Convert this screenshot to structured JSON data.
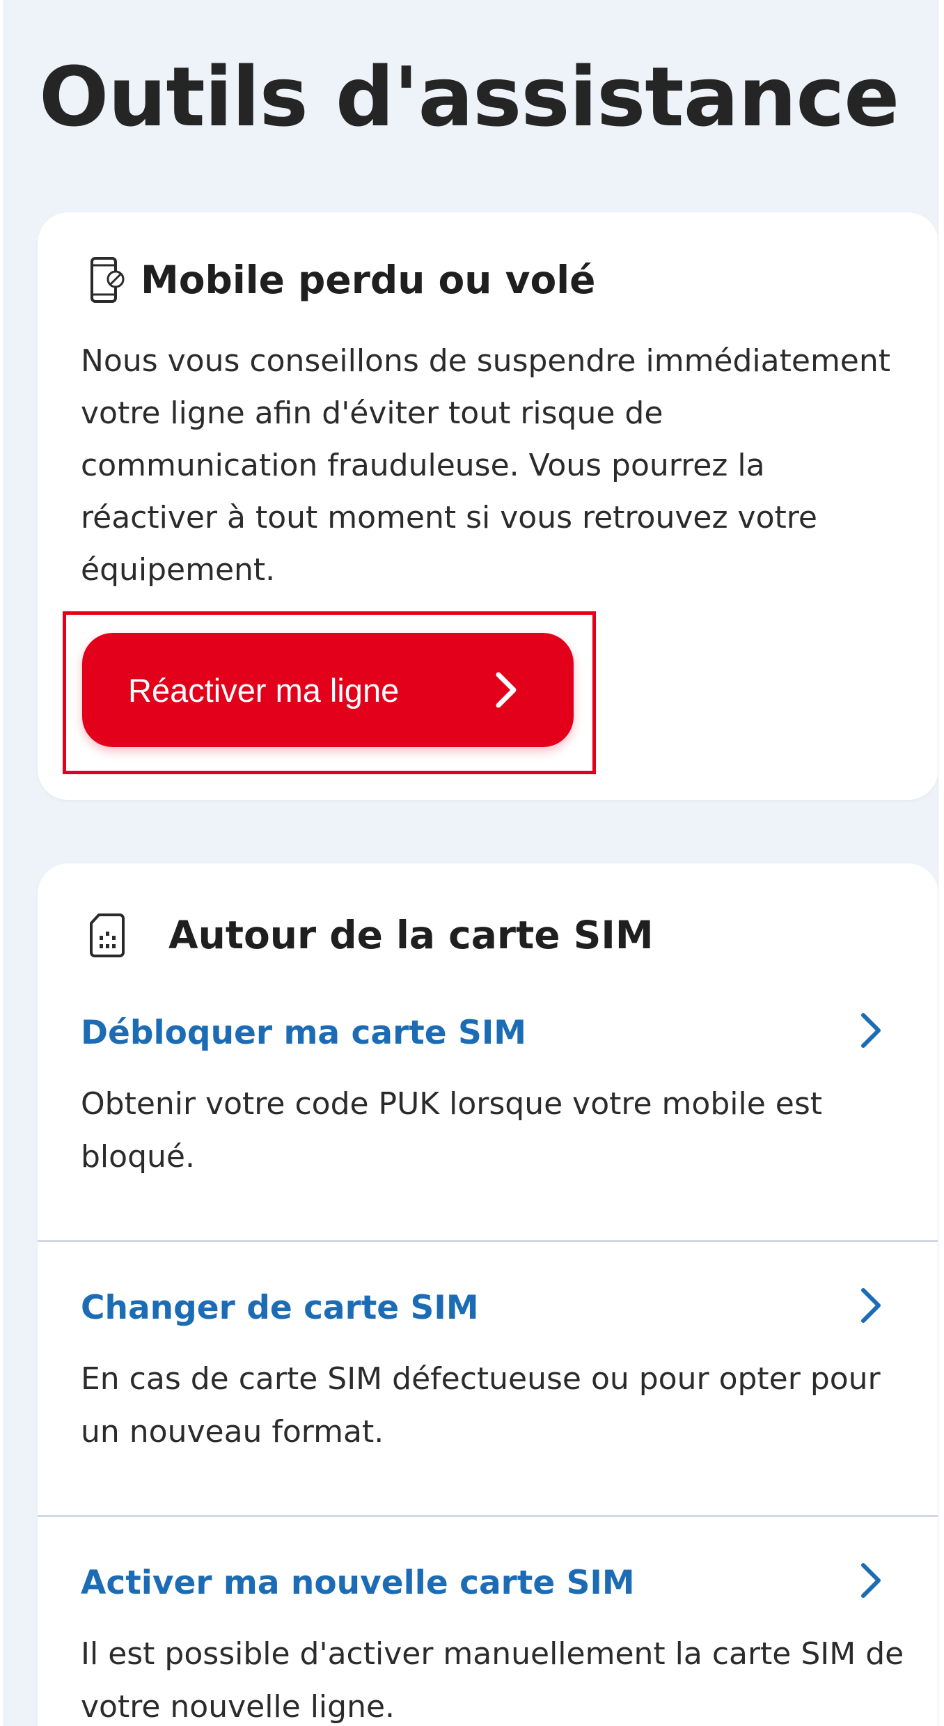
{
  "page": {
    "title": "Outils d'assistance"
  },
  "lost_card": {
    "title": "Mobile perdu ou volé",
    "icon": "phone-blocked-icon",
    "text": "Nous vous conseillons de suspendre immédiatement votre ligne afin d'éviter tout risque de communication frauduleuse. Vous pourrez la réactiver à tout moment si vous retrouvez votre équipement.",
    "button_label": "Réactiver ma ligne"
  },
  "sim_card": {
    "title": "Autour de la carte SIM",
    "icon": "sim-card-icon",
    "items": [
      {
        "label": "Débloquer ma carte SIM",
        "description": "Obtenir votre code PUK lorsque votre mobile est bloqué."
      },
      {
        "label": "Changer de carte SIM",
        "description": "En cas de carte SIM défectueuse ou pour opter pour un nouveau format."
      },
      {
        "label": "Activer ma nouvelle carte SIM",
        "description": "Il est possible d'activer manuellement la carte SIM de votre nouvelle ligne."
      }
    ]
  },
  "colors": {
    "brand_red": "#e2001a",
    "link_blue": "#1c6cb5",
    "background": "#eef3fa",
    "card": "#ffffff"
  }
}
